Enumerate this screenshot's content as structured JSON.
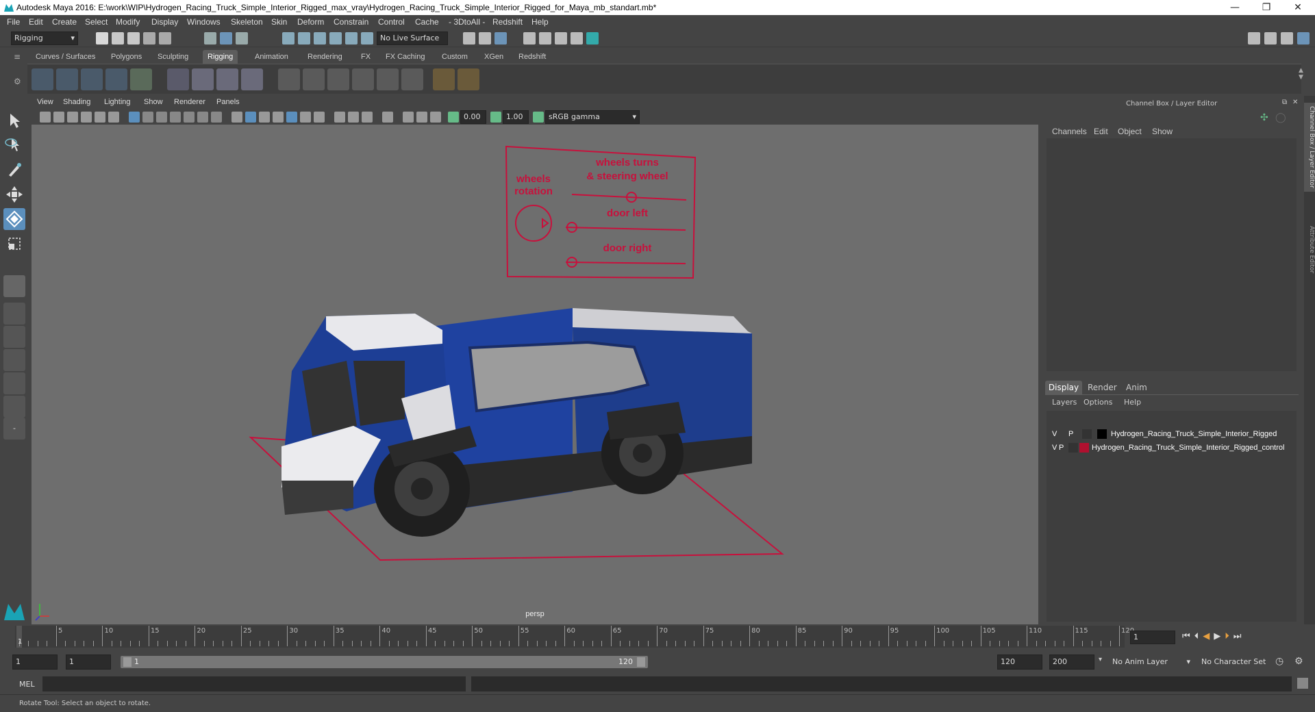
{
  "window": {
    "title": "Autodesk Maya 2016: E:\\work\\WIP\\Hydrogen_Racing_Truck_Simple_Interior_Rigged_max_vray\\Hydrogen_Racing_Truck_Simple_Interior_Rigged_for_Maya_mb_standart.mb*",
    "minimize": "—",
    "restore": "❐",
    "close": "✕"
  },
  "menu": [
    "File",
    "Edit",
    "Create",
    "Select",
    "Modify",
    "Display",
    "Windows",
    "Skeleton",
    "Skin",
    "Deform",
    "Constrain",
    "Control",
    "Cache",
    "- 3DtoAll -",
    "Redshift",
    "Help"
  ],
  "status": {
    "mode_select": "Rigging",
    "live_surface": "No Live Surface"
  },
  "shelf_tabs": [
    "Curves / Surfaces",
    "Polygons",
    "Sculpting",
    "Rigging",
    "Animation",
    "Rendering",
    "FX",
    "FX Caching",
    "Custom",
    "XGen",
    "Redshift"
  ],
  "active_shelf_tab": "Rigging",
  "viewport": {
    "menu": [
      "View",
      "Shading",
      "Lighting",
      "Show",
      "Renderer",
      "Panels"
    ],
    "exposure": "0.00",
    "gamma": "1.00",
    "color_space": "sRGB gamma",
    "camera_label": "persp"
  },
  "rig_panel": {
    "wheels_rotation": "wheels\nrotation",
    "wheels_turns": "wheels turns\n& steering wheel",
    "door_left": "door left",
    "door_right": "door right",
    "color": "#c8103c"
  },
  "channel_box": {
    "header": "Channel Box / Layer Editor",
    "menu": [
      "Channels",
      "Edit",
      "Object",
      "Show"
    ]
  },
  "layer_editor": {
    "tabs": [
      "Display",
      "Render",
      "Anim"
    ],
    "active_tab": "Display",
    "menu": [
      "Layers",
      "Options",
      "Help"
    ],
    "layers": [
      {
        "v": "V",
        "p": "P",
        "name": "Hydrogen_Racing_Truck_Simple_Interior_Rigged",
        "color": "#000000"
      },
      {
        "v": "V",
        "p": "P",
        "name": "Hydrogen_Racing_Truck_Simple_Interior_Rigged_control",
        "color": "#b0102f"
      }
    ]
  },
  "side_tabs": [
    "Channel Box / Layer Editor",
    "Attribute Editor"
  ],
  "timeline": {
    "ticks": [
      "5",
      "10",
      "15",
      "20",
      "25",
      "30",
      "35",
      "40",
      "45",
      "50",
      "55",
      "60",
      "65",
      "70",
      "75",
      "80",
      "85",
      "90",
      "95",
      "100",
      "105",
      "110",
      "115",
      "120"
    ],
    "first_frame": "1",
    "current_frame": "1"
  },
  "range": {
    "start": "1",
    "playback_start": "1",
    "slider_start": "1",
    "slider_end": "120",
    "playback_end": "120",
    "end": "200",
    "anim_layer": "No Anim Layer",
    "character_set": "No Character Set"
  },
  "command": {
    "label": "MEL"
  },
  "help_line": "Rotate Tool: Select an object to rotate."
}
